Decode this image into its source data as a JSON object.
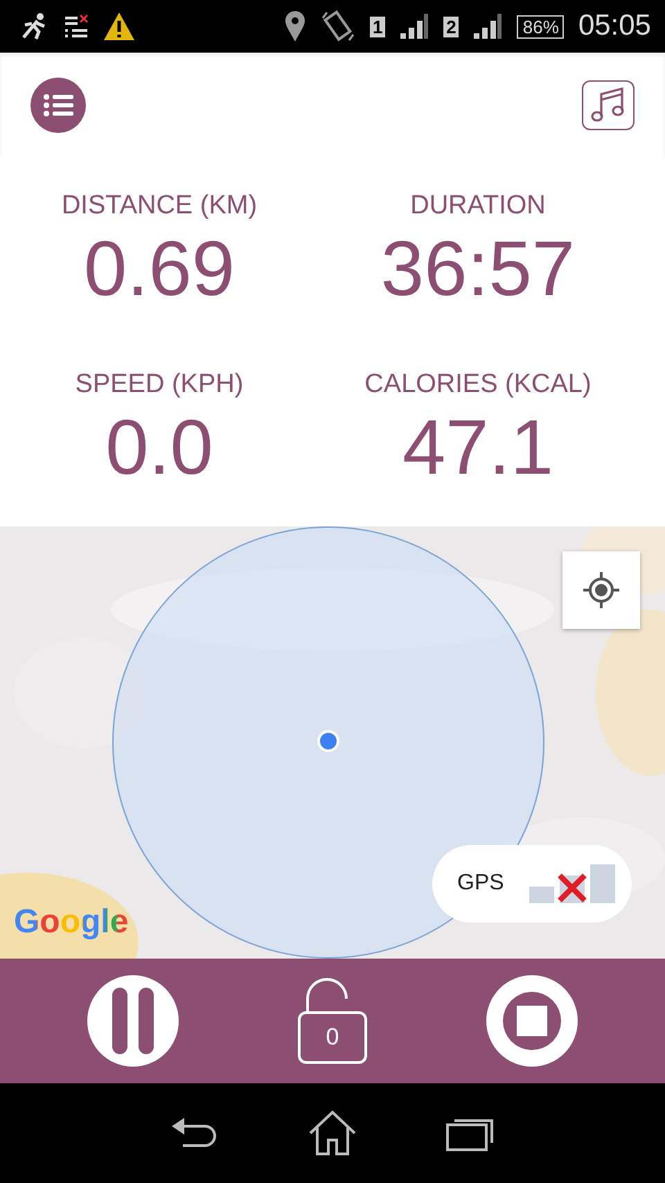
{
  "status_bar": {
    "sim_1": "1",
    "sim_2": "2",
    "battery": "86%",
    "time": "05:05"
  },
  "stats": [
    {
      "label": "DISTANCE (KM)",
      "value": "0.69"
    },
    {
      "label": "DURATION",
      "value": "36:57"
    },
    {
      "label": "SPEED (KPH)",
      "value": "0.0"
    },
    {
      "label": "CALORIES (KCAL)",
      "value": "47.1"
    }
  ],
  "map": {
    "attribution": "Google",
    "gps": {
      "label": "GPS",
      "has_fix": false
    }
  },
  "controls": {
    "lock_count": "0"
  }
}
